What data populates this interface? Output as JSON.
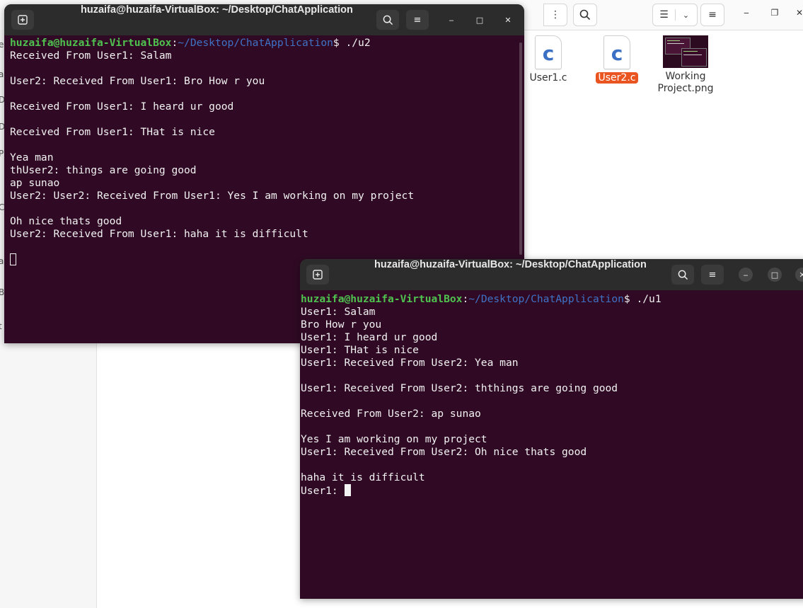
{
  "file_manager": {
    "header": {
      "more_icon": "more-vertical-icon",
      "search_icon": "search-icon",
      "list_view_icon": "list-view-icon",
      "view_dropdown_icon": "chevron-down-icon",
      "menu_icon": "hamburger-menu-icon",
      "minimize": "‒",
      "maximize": "❐",
      "close": "✕"
    },
    "sidebar_fragments": [
      "e",
      "a",
      "D",
      "D",
      "P",
      "C",
      "a",
      "a",
      "B",
      "t"
    ],
    "files": [
      {
        "name": "User1.c",
        "icon_letter": "c",
        "selected": false
      },
      {
        "name": "User2.c",
        "icon_letter": "c",
        "selected": true
      },
      {
        "name_line1": "Working",
        "name_line2": "Project.png",
        "icon": "image-thumbnail"
      }
    ],
    "selection_color": "#e95420"
  },
  "terminal_u2": {
    "title": "huzaifa@huzaifa-VirtualBox: ~/Desktop/ChatApplication",
    "prompt_user": "huzaifa@huzaifa-VirtualBox",
    "prompt_sep": ":",
    "prompt_path": "~/Desktop/ChatApplication",
    "prompt_cmd": "$ ./u2",
    "lines": [
      "Received From User1: Salam",
      "",
      "User2: Received From User1: Bro How r you",
      "",
      "Received From User1: I heard ur good",
      "",
      "Received From User1: THat is nice",
      "",
      "Yea man",
      "thUser2: things are going good",
      "ap sunao",
      "User2: User2: Received From User1: Yes I am working on my project",
      "",
      "Oh nice thats good",
      "User2: Received From User1: haha it is difficult",
      ""
    ],
    "buttons": {
      "new_tab": "⊞",
      "search": "search-icon",
      "menu": "hamburger-menu-icon",
      "minimize": "‒",
      "maximize": "□",
      "close": "✕"
    }
  },
  "terminal_u1": {
    "title": "huzaifa@huzaifa-VirtualBox: ~/Desktop/ChatApplication",
    "prompt_user": "huzaifa@huzaifa-VirtualBox",
    "prompt_sep": ":",
    "prompt_path": "~/Desktop/ChatApplication",
    "prompt_cmd": "$ ./u1",
    "lines": [
      "User1: Salam",
      "Bro How r you",
      "User1: I heard ur good",
      "User1: THat is nice",
      "User1: Received From User2: Yea man",
      "",
      "User1: Received From User2: ththings are going good",
      "",
      "Received From User2: ap sunao",
      "",
      "Yes I am working on my project",
      "User1: Received From User2: Oh nice thats good",
      "",
      "haha it is difficult"
    ],
    "input_prompt": "User1: ",
    "buttons": {
      "new_tab": "⊞",
      "search": "search-icon",
      "menu": "hamburger-menu-icon",
      "minimize": "‒",
      "maximize": "□",
      "close": "✕"
    }
  },
  "colors": {
    "terminal_bg": "#300a24",
    "titlebar_bg": "#2c2c2c",
    "prompt_user": "#4fc14f",
    "prompt_path": "#3f72c5"
  }
}
